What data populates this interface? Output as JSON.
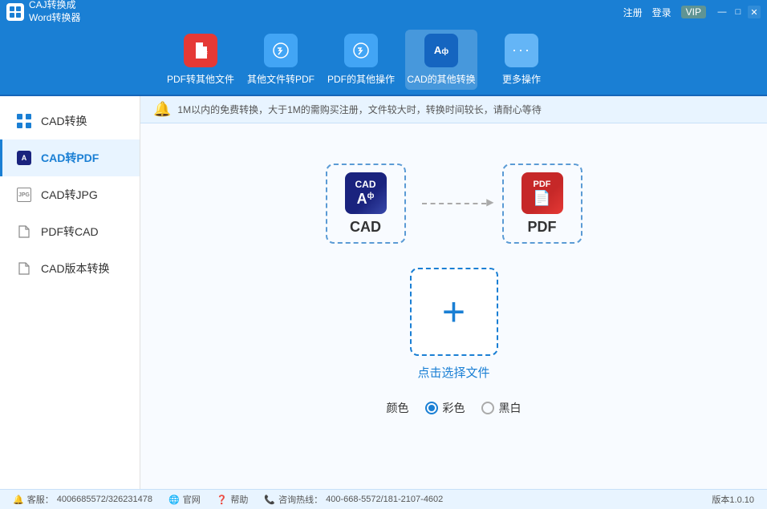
{
  "titlebar": {
    "app_name": "CAJ转换成\nWord转换器",
    "register": "注册",
    "login": "登录",
    "vip": "VIP",
    "minimize": "—",
    "maximize": "□",
    "close": "✕"
  },
  "toolbar": {
    "items": [
      {
        "id": "pdf-other",
        "label": "PDF转其他文件",
        "icon_type": "pdf-red",
        "icon": "≡"
      },
      {
        "id": "other-pdf",
        "label": "其他文件转PDF",
        "icon_type": "light-blue",
        "icon": "⚙"
      },
      {
        "id": "pdf-ops",
        "label": "PDF的其他操作",
        "icon_type": "light-blue",
        "icon": "⚙"
      },
      {
        "id": "cad-other",
        "label": "CAD的其他转换",
        "icon_type": "blue-bg",
        "icon": "Aф",
        "active": true
      },
      {
        "id": "more-ops",
        "label": "更多操作",
        "icon_type": "light-blue",
        "icon": "···"
      }
    ]
  },
  "sidebar": {
    "items": [
      {
        "id": "cad-convert",
        "label": "CAD转换",
        "icon": "⊞",
        "active": false
      },
      {
        "id": "cad-pdf",
        "label": "CAD转PDF",
        "icon": "A",
        "active": true
      },
      {
        "id": "cad-jpg",
        "label": "CAD转JPG",
        "icon": "JPG",
        "active": false
      },
      {
        "id": "pdf-cad",
        "label": "PDF转CAD",
        "icon": "📄",
        "active": false
      },
      {
        "id": "cad-version",
        "label": "CAD版本转换",
        "icon": "📄",
        "active": false
      }
    ]
  },
  "notice": {
    "icon": "🔔",
    "text": "1M以内的免费转换，大于1M的需购买注册，文件较大时，转换时间较长，请耐心等待"
  },
  "conversion": {
    "from_label": "CAD",
    "to_label": "PDF",
    "arrow": "→"
  },
  "upload": {
    "plus": "+",
    "label": "点击选择文件"
  },
  "color_options": {
    "label": "颜色",
    "options": [
      {
        "id": "color",
        "label": "彩色",
        "checked": true
      },
      {
        "id": "bw",
        "label": "黑白",
        "checked": false
      }
    ]
  },
  "statusbar": {
    "customer_label": "客服：",
    "customer_phone": "4006685572/326231478",
    "website_icon": "🌐",
    "website_label": "官网",
    "help_icon": "❓",
    "help_label": "帮助",
    "hotline_icon": "📞",
    "hotline_label": "咨询热线：",
    "hotline_phone": "400-668-5572/181-2107-4602",
    "version": "版本1.0.10"
  }
}
